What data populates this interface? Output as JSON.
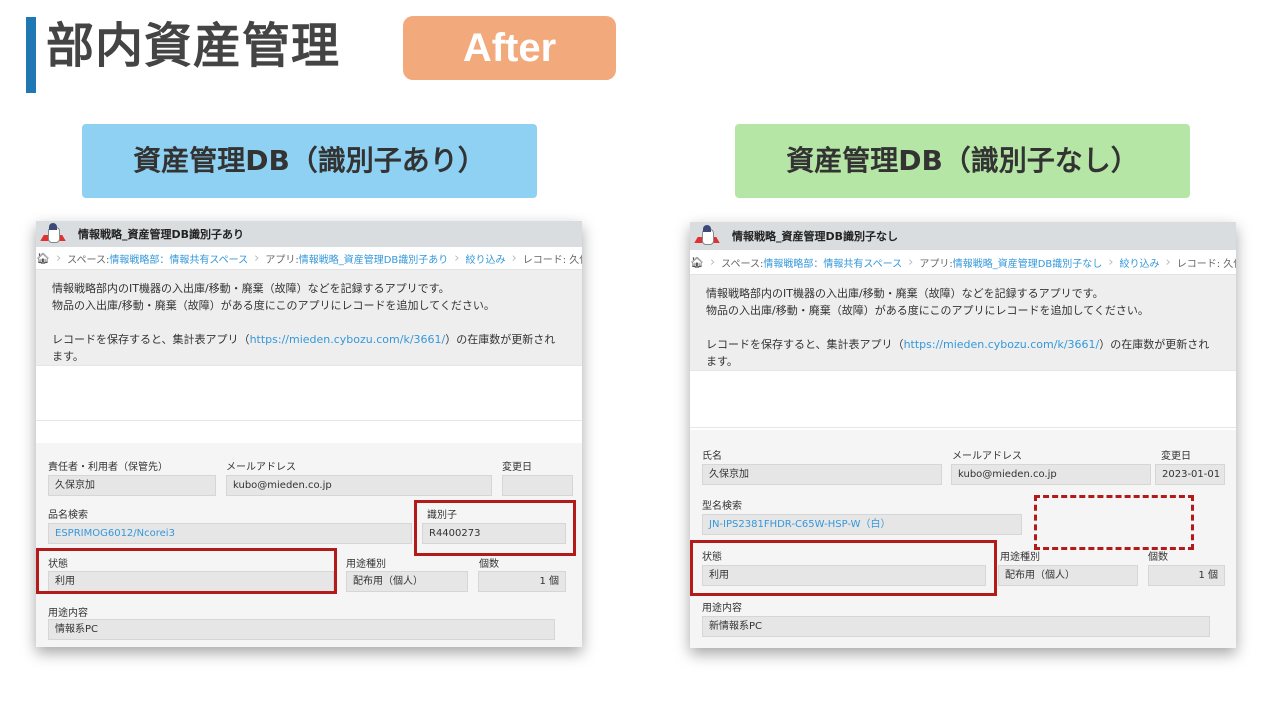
{
  "header": {
    "title": "部内資産管理",
    "badge": "After"
  },
  "panels": {
    "left_label": "資産管理DB（識別子あり）",
    "right_label": "資産管理DB（識別子なし）"
  },
  "colors": {
    "title_bar": "#1f77b4",
    "badge_bg": "#f2a97c",
    "left_label_bg": "#8ed1f2",
    "right_label_bg": "#b6e6a6",
    "highlight": "#b31b1b",
    "link": "#3498db"
  },
  "left": {
    "app_name": "情報戦略_資産管理DB識別子あり",
    "crumbs": {
      "space_prefix": "スペース: ",
      "space": "情報戦略部：情報共有スペース",
      "app_prefix": "アプリ: ",
      "app": "情報戦略_資産管理DB識別子あり",
      "filter": "絞り込み",
      "record": "レコード: 久保京加"
    },
    "desc": {
      "line1": "情報戦略部内のIT機器の入出庫/移動・廃棄（故障）などを記録するアプリです。",
      "line2": "物品の入出庫/移動・廃棄（故障）がある度にこのアプリにレコードを追加してください。",
      "line3_pre": "レコードを保存すると、集計表アプリ（",
      "url": "https://mieden.cybozu.com/k/3661/",
      "line3_post": "）の在庫数が更新されます。"
    },
    "fields": {
      "owner_label": "責任者・利用者（保管先）",
      "owner_value": "久保京加",
      "email_label": "メールアドレス",
      "email_value": "kubo@mieden.co.jp",
      "date_label": "変更日",
      "date_value": "",
      "product_label": "品名検索",
      "product_value": "ESPRIMOG6012/Ncorei3",
      "id_label": "識別子",
      "id_value": "R4400273",
      "status_label": "状態",
      "status_value": "利用",
      "usage_type_label": "用途種別",
      "usage_type_value": "配布用（個人）",
      "count_label": "個数",
      "count_value": "1 個",
      "usage_label": "用途内容",
      "usage_value": "情報系PC"
    }
  },
  "right": {
    "app_name": "情報戦略_資産管理DB識別子なし",
    "crumbs": {
      "space_prefix": "スペース: ",
      "space": "情報戦略部：情報共有スペース",
      "app_prefix": "アプリ: ",
      "app": "情報戦略_資産管理DB識別子なし",
      "filter": "絞り込み",
      "record": "レコード: 久保京加"
    },
    "desc": {
      "line1": "情報戦略部内のIT機器の入出庫/移動・廃棄（故障）などを記録するアプリです。",
      "line2": "物品の入出庫/移動・廃棄（故障）がある度にこのアプリにレコードを追加してください。",
      "line3_pre": "レコードを保存すると、集計表アプリ（",
      "url": "https://mieden.cybozu.com/k/3661/",
      "line3_post": "）の在庫数が更新されます。"
    },
    "fields": {
      "owner_label": "氏名",
      "owner_value": "久保京加",
      "email_label": "メールアドレス",
      "email_value": "kubo@mieden.co.jp",
      "date_label": "変更日",
      "date_value": "2023-01-01",
      "product_label": "型名検索",
      "product_value": "JN-IPS2381FHDR-C65W-HSP-W（白）",
      "status_label": "状態",
      "status_value": "利用",
      "usage_type_label": "用途種別",
      "usage_type_value": "配布用（個人）",
      "count_label": "個数",
      "count_value": "1 個",
      "usage_label": "用途内容",
      "usage_value": "新情報系PC"
    }
  }
}
